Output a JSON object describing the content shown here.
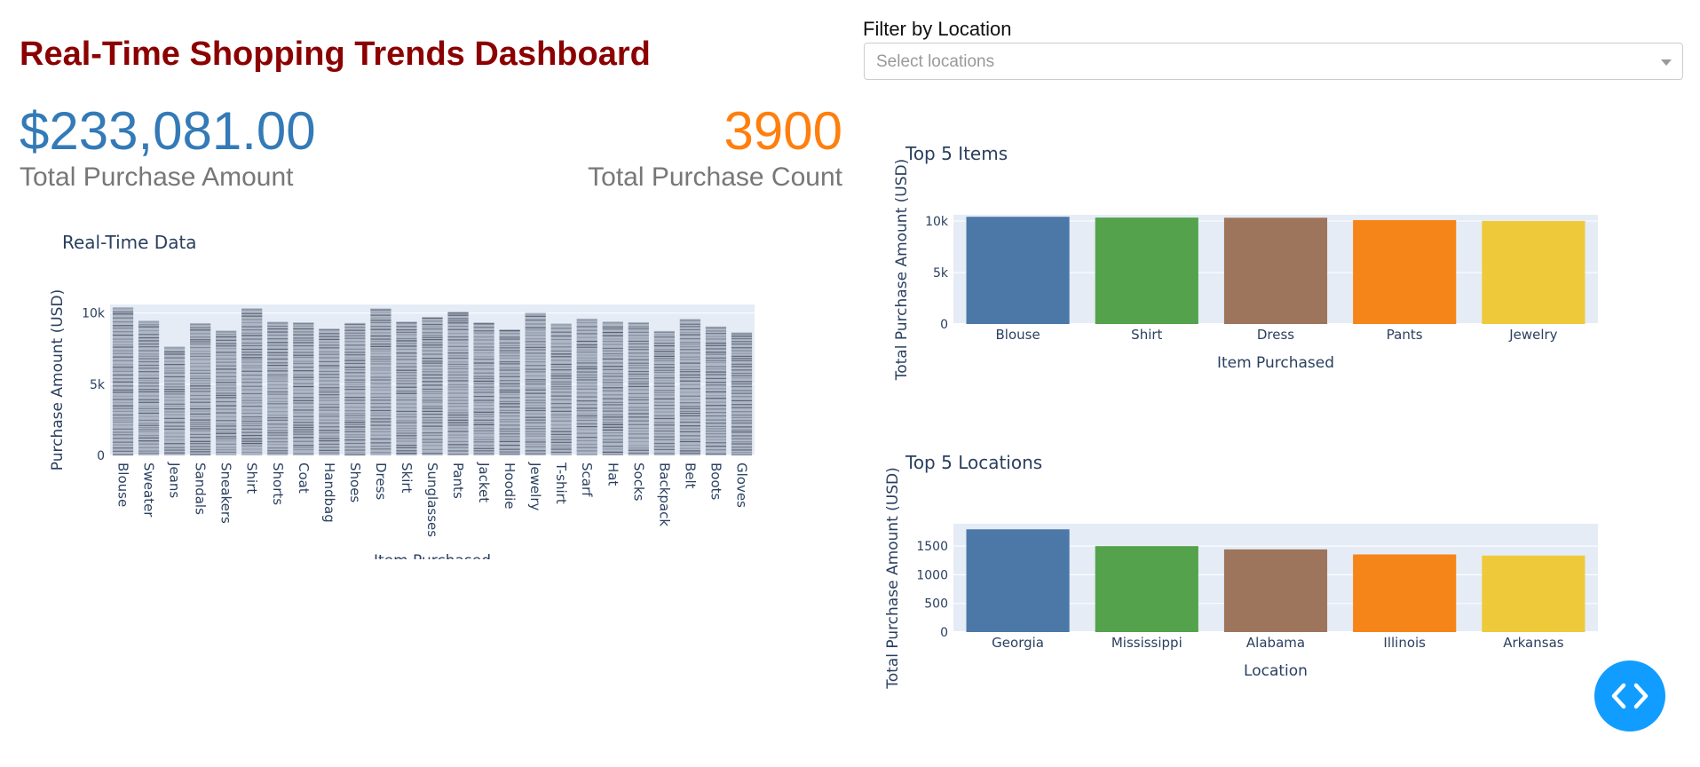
{
  "header": {
    "title": "Real-Time Shopping Trends Dashboard"
  },
  "kpis": {
    "total_amount_value": "$233,081.00",
    "total_amount_label": "Total Purchase Amount",
    "total_count_value": "3900",
    "total_count_label": "Total Purchase Count",
    "amount_color": "#337ab7",
    "count_color": "#ff7f0e"
  },
  "filter": {
    "label": "Filter by Location",
    "placeholder": "Select locations"
  },
  "fab": {
    "icon": "code-icon",
    "color": "#119dff"
  },
  "chart_data": [
    {
      "type": "bar",
      "title": "Real-Time Data",
      "xlabel": "Item Purchased",
      "ylabel": "Purchase Amount (USD)",
      "ylim": [
        0,
        10600
      ],
      "yticks": [
        0,
        5000,
        10000
      ],
      "ytick_labels": [
        "0",
        "5k",
        "10k"
      ],
      "categories": [
        "Blouse",
        "Sweater",
        "Jeans",
        "Sandals",
        "Sneakers",
        "Shirt",
        "Shorts",
        "Coat",
        "Handbag",
        "Shoes",
        "Dress",
        "Skirt",
        "Sunglasses",
        "Pants",
        "Jacket",
        "Hoodie",
        "Jewelry",
        "T-shirt",
        "Scarf",
        "Hat",
        "Socks",
        "Backpack",
        "Belt",
        "Boots",
        "Gloves"
      ],
      "values": [
        10410,
        9464,
        7647,
        9296,
        8771,
        10332,
        9391,
        9349,
        8914,
        9304,
        10320,
        9401,
        9730,
        10090,
        9340,
        8852,
        10010,
        9263,
        9607,
        9402,
        9360,
        8743,
        9583,
        9055,
        8640
      ],
      "color": "#aeb7c6",
      "stripe_color": "#2f3545",
      "grid": true
    },
    {
      "type": "bar",
      "title": "Top 5 Items",
      "xlabel": "Item Purchased",
      "ylabel": "Total Purchase Amount (USD)",
      "ylim": [
        0,
        10600
      ],
      "yticks": [
        0,
        5000,
        10000
      ],
      "ytick_labels": [
        "0",
        "5k",
        "10k"
      ],
      "categories": [
        "Blouse",
        "Shirt",
        "Dress",
        "Pants",
        "Jewelry"
      ],
      "values": [
        10410,
        10332,
        10320,
        10090,
        10010
      ],
      "colors": [
        "#4c78a8",
        "#54a24b",
        "#9d755d",
        "#f58518",
        "#eeca3b"
      ],
      "grid": true
    },
    {
      "type": "bar",
      "title": "Top 5 Locations",
      "xlabel": "Location",
      "ylabel": "Total Purchase Amount (USD)",
      "ylim": [
        0,
        1890
      ],
      "yticks": [
        0,
        500,
        1000,
        1500
      ],
      "ytick_labels": [
        "0",
        "500",
        "1000",
        "1500"
      ],
      "categories": [
        "Georgia",
        "Mississippi",
        "Alabama",
        "Illinois",
        "Arkansas"
      ],
      "values": [
        1793,
        1500,
        1443,
        1355,
        1335
      ],
      "colors": [
        "#4c78a8",
        "#54a24b",
        "#9d755d",
        "#f58518",
        "#eeca3b"
      ],
      "grid": true
    }
  ]
}
